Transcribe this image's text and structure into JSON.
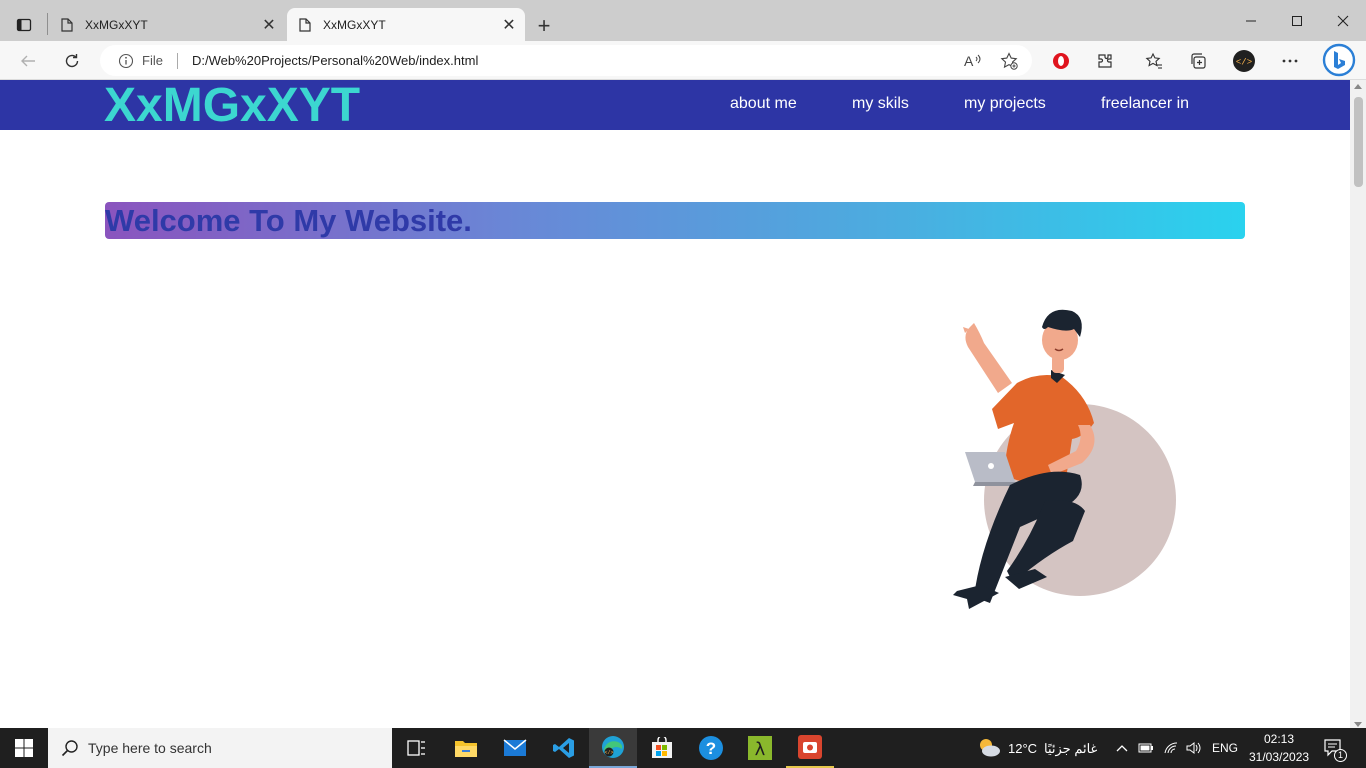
{
  "browser": {
    "tabs": [
      {
        "title": "XxMGxXYT",
        "active": false
      },
      {
        "title": "XxMGxXYT",
        "active": true
      }
    ],
    "address": {
      "scheme_label": "File",
      "url": "D:/Web%20Projects/Personal%20Web/index.html"
    }
  },
  "site": {
    "logo": "XxMGxXYT",
    "nav": [
      "about me",
      "my skils",
      "my projects",
      "freelancer in"
    ],
    "welcome": "Welcome To My Website.",
    "colors": {
      "header_bg": "#2d35a5",
      "logo": "#3cd7d0",
      "welcome_text": "#2f3aa8",
      "gradient_start": "#8a54be",
      "gradient_end": "#2ad2ee"
    },
    "illustration": "man-sitting-on-beanbag-with-laptop"
  },
  "taskbar": {
    "search_placeholder": "Type here to search",
    "weather": {
      "temp": "12°C",
      "condition": "غائم جزئيًا"
    },
    "language": "ENG",
    "time": "02:13",
    "date": "31/03/2023",
    "notification_count": "1",
    "apps": [
      "task-view",
      "file-explorer",
      "mail",
      "vscode",
      "edge",
      "microsoft-store",
      "help",
      "lambda-app",
      "screen-recorder"
    ]
  }
}
